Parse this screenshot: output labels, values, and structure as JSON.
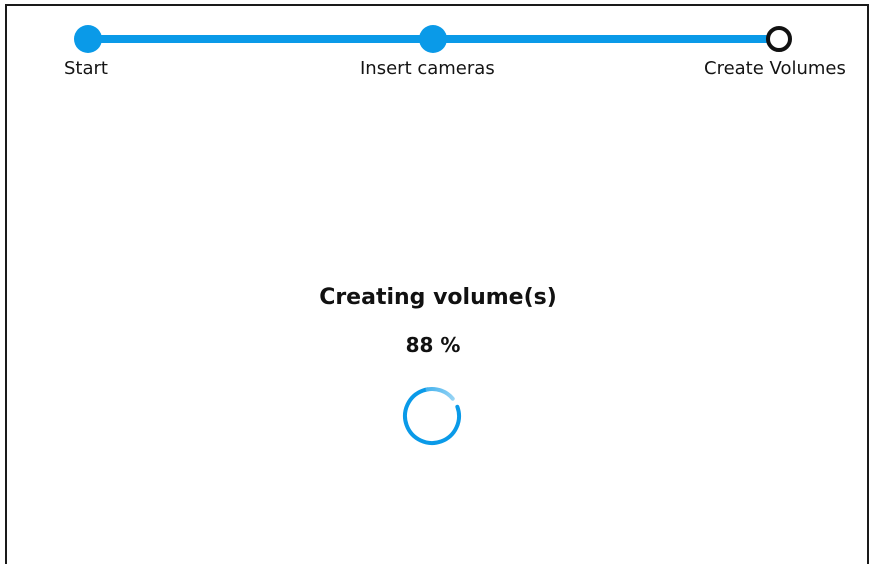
{
  "wizard": {
    "steps": [
      {
        "label": "Start",
        "state": "completed"
      },
      {
        "label": "Insert cameras",
        "state": "completed"
      },
      {
        "label": "Create Volumes",
        "state": "current"
      }
    ]
  },
  "status": {
    "title": "Creating volume(s)",
    "percent": "88 %",
    "spinner_icon": "loading-spinner-icon"
  },
  "colors": {
    "accent": "#0a9ae8",
    "current_step_border": "#111111",
    "text": "#111111",
    "background": "#ffffff"
  }
}
